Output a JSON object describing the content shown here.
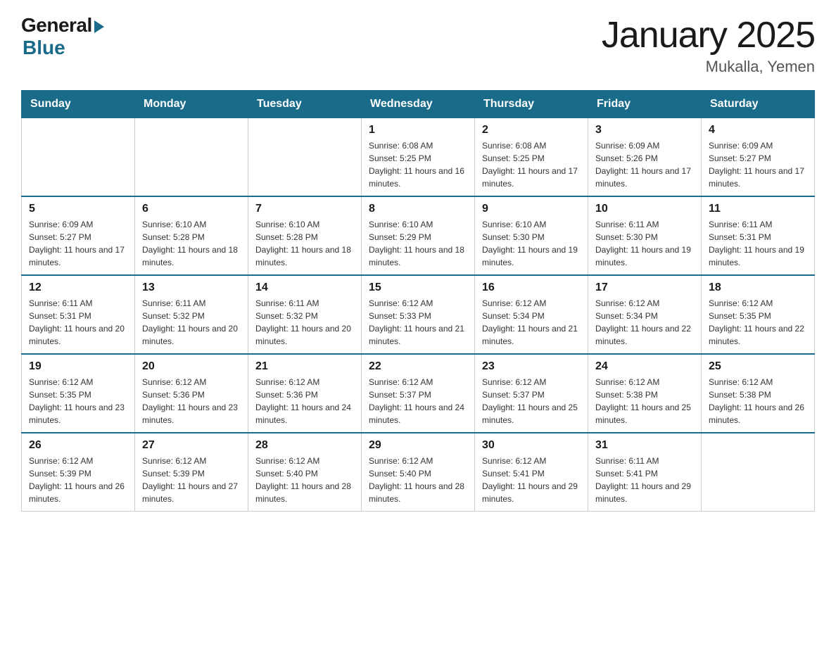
{
  "logo": {
    "general": "General",
    "blue": "Blue"
  },
  "title": "January 2025",
  "subtitle": "Mukalla, Yemen",
  "days_of_week": [
    "Sunday",
    "Monday",
    "Tuesday",
    "Wednesday",
    "Thursday",
    "Friday",
    "Saturday"
  ],
  "weeks": [
    [
      {
        "day": "",
        "info": ""
      },
      {
        "day": "",
        "info": ""
      },
      {
        "day": "",
        "info": ""
      },
      {
        "day": "1",
        "info": "Sunrise: 6:08 AM\nSunset: 5:25 PM\nDaylight: 11 hours and 16 minutes."
      },
      {
        "day": "2",
        "info": "Sunrise: 6:08 AM\nSunset: 5:25 PM\nDaylight: 11 hours and 17 minutes."
      },
      {
        "day": "3",
        "info": "Sunrise: 6:09 AM\nSunset: 5:26 PM\nDaylight: 11 hours and 17 minutes."
      },
      {
        "day": "4",
        "info": "Sunrise: 6:09 AM\nSunset: 5:27 PM\nDaylight: 11 hours and 17 minutes."
      }
    ],
    [
      {
        "day": "5",
        "info": "Sunrise: 6:09 AM\nSunset: 5:27 PM\nDaylight: 11 hours and 17 minutes."
      },
      {
        "day": "6",
        "info": "Sunrise: 6:10 AM\nSunset: 5:28 PM\nDaylight: 11 hours and 18 minutes."
      },
      {
        "day": "7",
        "info": "Sunrise: 6:10 AM\nSunset: 5:28 PM\nDaylight: 11 hours and 18 minutes."
      },
      {
        "day": "8",
        "info": "Sunrise: 6:10 AM\nSunset: 5:29 PM\nDaylight: 11 hours and 18 minutes."
      },
      {
        "day": "9",
        "info": "Sunrise: 6:10 AM\nSunset: 5:30 PM\nDaylight: 11 hours and 19 minutes."
      },
      {
        "day": "10",
        "info": "Sunrise: 6:11 AM\nSunset: 5:30 PM\nDaylight: 11 hours and 19 minutes."
      },
      {
        "day": "11",
        "info": "Sunrise: 6:11 AM\nSunset: 5:31 PM\nDaylight: 11 hours and 19 minutes."
      }
    ],
    [
      {
        "day": "12",
        "info": "Sunrise: 6:11 AM\nSunset: 5:31 PM\nDaylight: 11 hours and 20 minutes."
      },
      {
        "day": "13",
        "info": "Sunrise: 6:11 AM\nSunset: 5:32 PM\nDaylight: 11 hours and 20 minutes."
      },
      {
        "day": "14",
        "info": "Sunrise: 6:11 AM\nSunset: 5:32 PM\nDaylight: 11 hours and 20 minutes."
      },
      {
        "day": "15",
        "info": "Sunrise: 6:12 AM\nSunset: 5:33 PM\nDaylight: 11 hours and 21 minutes."
      },
      {
        "day": "16",
        "info": "Sunrise: 6:12 AM\nSunset: 5:34 PM\nDaylight: 11 hours and 21 minutes."
      },
      {
        "day": "17",
        "info": "Sunrise: 6:12 AM\nSunset: 5:34 PM\nDaylight: 11 hours and 22 minutes."
      },
      {
        "day": "18",
        "info": "Sunrise: 6:12 AM\nSunset: 5:35 PM\nDaylight: 11 hours and 22 minutes."
      }
    ],
    [
      {
        "day": "19",
        "info": "Sunrise: 6:12 AM\nSunset: 5:35 PM\nDaylight: 11 hours and 23 minutes."
      },
      {
        "day": "20",
        "info": "Sunrise: 6:12 AM\nSunset: 5:36 PM\nDaylight: 11 hours and 23 minutes."
      },
      {
        "day": "21",
        "info": "Sunrise: 6:12 AM\nSunset: 5:36 PM\nDaylight: 11 hours and 24 minutes."
      },
      {
        "day": "22",
        "info": "Sunrise: 6:12 AM\nSunset: 5:37 PM\nDaylight: 11 hours and 24 minutes."
      },
      {
        "day": "23",
        "info": "Sunrise: 6:12 AM\nSunset: 5:37 PM\nDaylight: 11 hours and 25 minutes."
      },
      {
        "day": "24",
        "info": "Sunrise: 6:12 AM\nSunset: 5:38 PM\nDaylight: 11 hours and 25 minutes."
      },
      {
        "day": "25",
        "info": "Sunrise: 6:12 AM\nSunset: 5:38 PM\nDaylight: 11 hours and 26 minutes."
      }
    ],
    [
      {
        "day": "26",
        "info": "Sunrise: 6:12 AM\nSunset: 5:39 PM\nDaylight: 11 hours and 26 minutes."
      },
      {
        "day": "27",
        "info": "Sunrise: 6:12 AM\nSunset: 5:39 PM\nDaylight: 11 hours and 27 minutes."
      },
      {
        "day": "28",
        "info": "Sunrise: 6:12 AM\nSunset: 5:40 PM\nDaylight: 11 hours and 28 minutes."
      },
      {
        "day": "29",
        "info": "Sunrise: 6:12 AM\nSunset: 5:40 PM\nDaylight: 11 hours and 28 minutes."
      },
      {
        "day": "30",
        "info": "Sunrise: 6:12 AM\nSunset: 5:41 PM\nDaylight: 11 hours and 29 minutes."
      },
      {
        "day": "31",
        "info": "Sunrise: 6:11 AM\nSunset: 5:41 PM\nDaylight: 11 hours and 29 minutes."
      },
      {
        "day": "",
        "info": ""
      }
    ]
  ]
}
